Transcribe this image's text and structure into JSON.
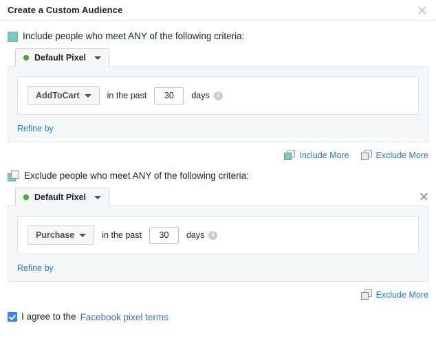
{
  "header": {
    "title": "Create a Custom Audience",
    "close_icon": "close-icon"
  },
  "include_section": {
    "marker_icon": "include-marker-icon",
    "heading": "Include people who meet ANY of the following criteria:",
    "pixel_tab": {
      "status_icon": "green-status-dot-icon",
      "name": "Default Pixel",
      "caret_icon": "chevron-down-icon"
    },
    "criteria": {
      "event_label": "AddToCart",
      "event_caret_icon": "chevron-down-icon",
      "in_the_past": "in the past",
      "days_value": "30",
      "days_placeholder": "30",
      "days_label": "days",
      "info_icon": "info-icon"
    },
    "refine_link": "Refine by"
  },
  "more_row_1": {
    "include_more": {
      "icon": "include-more-icon",
      "label": "Include More"
    },
    "exclude_more": {
      "icon": "exclude-more-icon",
      "label": "Exclude More"
    }
  },
  "exclude_section": {
    "marker_icon": "exclude-marker-icon",
    "heading": "Exclude people who meet ANY of the following criteria:",
    "pixel_tab": {
      "status_icon": "green-status-dot-icon",
      "name": "Default Pixel",
      "caret_icon": "chevron-down-icon"
    },
    "remove_icon": "remove-section-icon",
    "criteria": {
      "event_label": "Purchase",
      "event_caret_icon": "chevron-down-icon",
      "in_the_past": "in the past",
      "days_value": "30",
      "days_placeholder": "30",
      "days_label": "days",
      "info_icon": "info-icon"
    },
    "refine_link": "Refine by"
  },
  "more_row_2": {
    "exclude_more": {
      "icon": "exclude-more-icon",
      "label": "Exclude More"
    }
  },
  "terms": {
    "checkbox_state": "checked",
    "text": "I agree to the",
    "link": "Facebook pixel terms"
  },
  "colors": {
    "teal": "#6dcfc1",
    "link_blue": "#2077e8",
    "checkbox_blue": "#4080ff",
    "status_green": "#42b72a",
    "panel_gray": "#f6f7f8"
  }
}
